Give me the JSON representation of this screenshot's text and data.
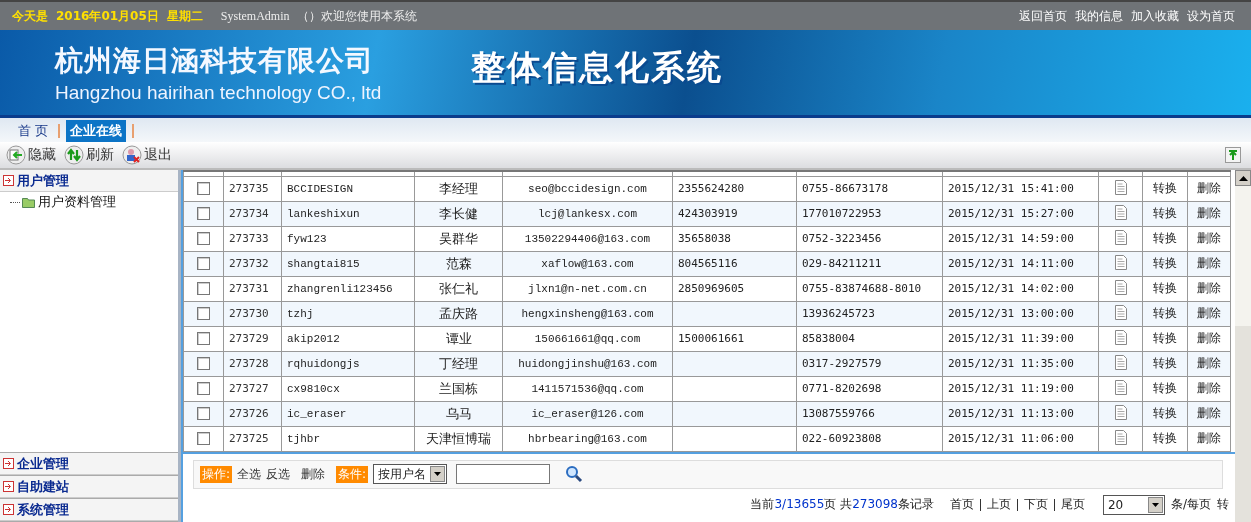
{
  "top_bar": {
    "date_label": "今天是",
    "date": "2016年01月05日",
    "weekday": "星期二",
    "user": "SystemAdmin",
    "greeting": "（）欢迎您使用本系统",
    "links": [
      "返回首页",
      "我的信息",
      "加入收藏",
      "设为首页"
    ]
  },
  "banner": {
    "company_cn": "杭州海日涵科技有限公司",
    "company_en": "Hangzhou hairihan technology CO., ltd",
    "system_title": "整体信息化系统"
  },
  "tabs": [
    {
      "label": "首 页",
      "selected": false
    },
    {
      "label": "企业在线",
      "selected": true
    }
  ],
  "toolbar": [
    {
      "label": "隐藏",
      "kind": "hide"
    },
    {
      "label": "刷新",
      "kind": "refresh"
    },
    {
      "label": "退出",
      "kind": "exit"
    }
  ],
  "sidebar": {
    "items": [
      {
        "label": "用户管理",
        "expanded": true,
        "children": [
          {
            "label": "用户资料管理"
          }
        ]
      },
      {
        "label": "企业管理",
        "expanded": false
      },
      {
        "label": "自助建站",
        "expanded": false
      },
      {
        "label": "系统管理",
        "expanded": false
      }
    ]
  },
  "table": {
    "rows": [
      {
        "checked": false,
        "id": "273735",
        "username": "BCCIDESIGN",
        "name": "李经理",
        "email": "seo@bccidesign.com",
        "qq": "2355624280",
        "phone": "0755-86673178",
        "time": "2015/12/31 15:41:00",
        "convert": "转换",
        "delete": "删除"
      },
      {
        "checked": false,
        "id": "273734",
        "username": "lankeshixun",
        "name": "李长健",
        "email": "lcj@lankesx.com",
        "qq": "424303919",
        "phone": "177010722953",
        "time": "2015/12/31 15:27:00",
        "convert": "转换",
        "delete": "删除"
      },
      {
        "checked": false,
        "id": "273733",
        "username": "fyw123",
        "name": "吴群华",
        "email": "13502294406@163.com",
        "qq": "35658038",
        "phone": "0752-3223456",
        "time": "2015/12/31 14:59:00",
        "convert": "转换",
        "delete": "删除"
      },
      {
        "checked": false,
        "id": "273732",
        "username": "shangtai815",
        "name": "范森",
        "email": "xaflow@163.com",
        "qq": "804565116",
        "phone": "029-84211211",
        "time": "2015/12/31 14:11:00",
        "convert": "转换",
        "delete": "删除"
      },
      {
        "checked": false,
        "id": "273731",
        "username": "zhangrenli123456",
        "name": "张仁礼",
        "email": "jlxn1@n-net.com.cn",
        "qq": "2850969605",
        "phone": "0755-83874688-8010",
        "time": "2015/12/31 14:02:00",
        "convert": "转换",
        "delete": "删除"
      },
      {
        "checked": false,
        "id": "273730",
        "username": "tzhj",
        "name": "孟庆路",
        "email": "hengxinsheng@163.com",
        "phone": "13936245723",
        "time": "2015/12/31 13:00:00",
        "convert": "转换",
        "delete": "删除"
      },
      {
        "checked": false,
        "id": "273729",
        "username": "akip2012",
        "name": "谭业",
        "email": "150661661@qq.com",
        "qq": "1500061661",
        "phone": "85838004",
        "time": "2015/12/31 11:39:00",
        "convert": "转换",
        "delete": "删除"
      },
      {
        "checked": false,
        "id": "273728",
        "username": "rqhuidongjs",
        "name": "丁经理",
        "email": "huidongjinshu@163.com",
        "phone": "0317-2927579",
        "time": "2015/12/31 11:35:00",
        "convert": "转换",
        "delete": "删除"
      },
      {
        "checked": false,
        "id": "273727",
        "username": "cx9810cx",
        "name": "兰国栋",
        "email": "1411571536@qq.com",
        "phone": "0771-8202698",
        "time": "2015/12/31 11:19:00",
        "convert": "转换",
        "delete": "删除"
      },
      {
        "checked": false,
        "id": "273726",
        "username": "ic_eraser",
        "name": "乌马",
        "email": "ic_eraser@126.com",
        "phone": "13087559766",
        "time": "2015/12/31 11:13:00",
        "convert": "转换",
        "delete": "删除"
      },
      {
        "checked": false,
        "id": "273725",
        "username": "tjhbr",
        "name": "天津恒博瑞",
        "email": "hbrbearing@163.com",
        "phone": "022-60923808",
        "time": "2015/12/31 11:06:00",
        "convert": "转换",
        "delete": "删除"
      }
    ]
  },
  "actions": {
    "ops_label": "操作:",
    "select_all": "全选",
    "invert": "反选",
    "delete": "删除",
    "cond_label": "条件:",
    "condition": "按用户名"
  },
  "pager": {
    "prefix": "当前",
    "page": "3/13655",
    "mid": "页 共",
    "total": "273098",
    "suffix": "条记录",
    "first": "首页",
    "prev": "上页",
    "next": "下页",
    "last": "尾页",
    "per_page": "20",
    "per_label": "条/每页",
    "goto": "转"
  }
}
